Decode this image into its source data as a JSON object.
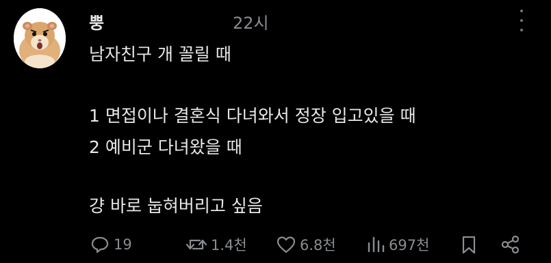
{
  "post": {
    "username": "뿡",
    "time": "22시",
    "lines": [
      "남자친구 개 꼴릴 때",
      "1 면접이나 결혼식 다녀와서 정장 입고있을 때",
      "2 예비군 다녀왔을 때",
      "걍 바로 눕혀버리고 싶음"
    ]
  },
  "actions": {
    "replies": "19",
    "reposts": "1.4천",
    "likes": "6.8천",
    "views": "697천"
  },
  "icons": {
    "reply": "reply-icon",
    "repost": "repost-icon",
    "like": "heart-icon",
    "views": "views-icon",
    "bookmark": "bookmark-icon",
    "share": "share-icon",
    "more": "more-icon"
  },
  "colors": {
    "background": "#000000",
    "text": "#e7e9ea",
    "muted": "#8a8d91"
  }
}
